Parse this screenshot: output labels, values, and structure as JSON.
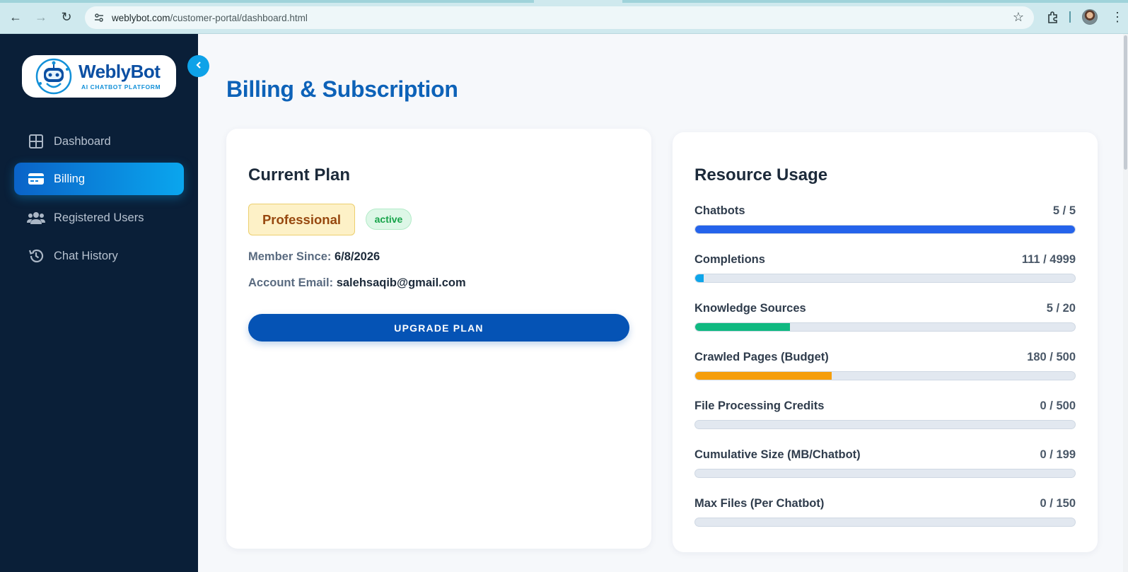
{
  "browser": {
    "url_domain": "weblybot.com",
    "url_path": "/customer-portal/dashboard.html"
  },
  "sidebar": {
    "logo": {
      "title": "WeblyBot",
      "subtitle": "AI CHATBOT PLATFORM"
    },
    "items": [
      {
        "label": "Dashboard",
        "icon": "grid-icon",
        "active": false
      },
      {
        "label": "Billing",
        "icon": "credit-card-icon",
        "active": true
      },
      {
        "label": "Registered Users",
        "icon": "users-icon",
        "active": false
      },
      {
        "label": "Chat History",
        "icon": "history-icon",
        "active": false
      }
    ]
  },
  "page": {
    "title": "Billing & Subscription"
  },
  "plan_card": {
    "title": "Current Plan",
    "plan_name": "Professional",
    "status": "active",
    "member_since_label": "Member Since:",
    "member_since_value": "6/8/2026",
    "email_label": "Account Email:",
    "email_value": "salehsaqib@gmail.com",
    "upgrade_label": "UPGRADE PLAN"
  },
  "usage_card": {
    "title": "Resource Usage",
    "rows": [
      {
        "label": "Chatbots",
        "value": "5 / 5",
        "used": 5,
        "limit": 5,
        "color": "#2563eb"
      },
      {
        "label": "Completions",
        "value": "111 / 4999",
        "used": 111,
        "limit": 4999,
        "color": "#0ea5e9"
      },
      {
        "label": "Knowledge Sources",
        "value": "5 / 20",
        "used": 5,
        "limit": 20,
        "color": "#10b981"
      },
      {
        "label": "Crawled Pages (Budget)",
        "value": "180 / 500",
        "used": 180,
        "limit": 500,
        "color": "#f59e0b"
      },
      {
        "label": "File Processing Credits",
        "value": "0 / 500",
        "used": 0,
        "limit": 500,
        "color": "#8b5cf6"
      },
      {
        "label": "Cumulative Size (MB/Chatbot)",
        "value": "0 / 199",
        "used": 0,
        "limit": 199,
        "color": "#8b5cf6"
      },
      {
        "label": "Max Files (Per Chatbot)",
        "value": "0 / 150",
        "used": 0,
        "limit": 150,
        "color": "#8b5cf6"
      }
    ]
  },
  "colors": {
    "sidebar_bg": "#0a1f38",
    "accent": "#0ea2e8",
    "title_blue": "#0d62b8",
    "button_blue": "#0553b5"
  }
}
